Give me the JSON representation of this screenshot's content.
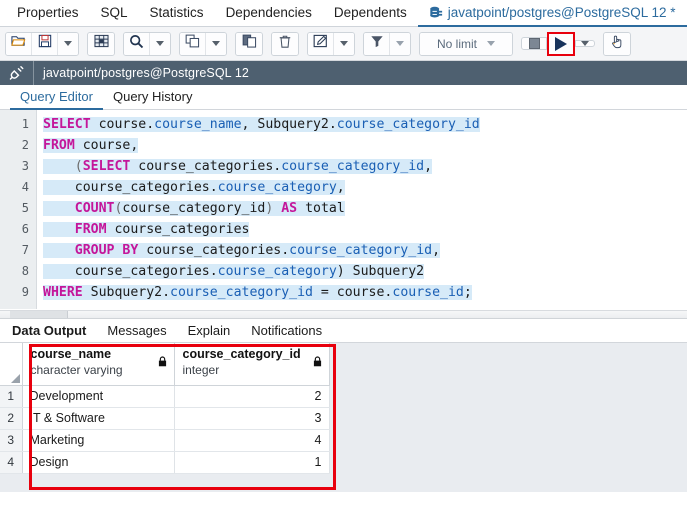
{
  "object_tabs": [
    {
      "label": "Properties",
      "active": false,
      "icon": null
    },
    {
      "label": "SQL",
      "active": false,
      "icon": null
    },
    {
      "label": "Statistics",
      "active": false,
      "icon": null
    },
    {
      "label": "Dependencies",
      "active": false,
      "icon": null
    },
    {
      "label": "Dependents",
      "active": false,
      "icon": null
    },
    {
      "label": "javatpoint/postgres@PostgreSQL 12 *",
      "active": true,
      "icon": "database-icon"
    }
  ],
  "toolbar": {
    "open_file_label": "open-file",
    "save_file_label": "save-file",
    "save_caret_label": "save-options",
    "edit_grid_label": "edit-grid",
    "find_label": "find",
    "find_caret_label": "find-options",
    "copy_label": "copy",
    "copy_caret_label": "copy-options",
    "paste_label": "paste",
    "delete_label": "delete",
    "edit_label": "edit-options",
    "edit_caret_label": "edit-caret",
    "filter_label": "filter",
    "filter_caret_label": "filter-options",
    "row_limit_value": "No limit",
    "stop_label": "stop",
    "execute_label": "execute-query",
    "execute_caret_label": "execute-options",
    "commit_label": "macro"
  },
  "connection": {
    "icon": "plug-icon",
    "text": "javatpoint/postgres@PostgreSQL 12"
  },
  "query_tabs": [
    {
      "label": "Query Editor",
      "active": true
    },
    {
      "label": "Query History",
      "active": false
    }
  ],
  "editor": {
    "line_numbers": [
      "1",
      "2",
      "3",
      "4",
      "5",
      "6",
      "7",
      "8",
      "9"
    ],
    "lines": [
      [
        {
          "t": "SELECT",
          "c": "kw"
        },
        {
          "t": " course.",
          "c": "pl"
        },
        {
          "t": "course_name",
          "c": "fld"
        },
        {
          "t": ", Subquery2.",
          "c": "pl"
        },
        {
          "t": "course_category_id",
          "c": "fld"
        }
      ],
      [
        {
          "t": "FROM",
          "c": "kw"
        },
        {
          "t": " course,",
          "c": "pl"
        }
      ],
      [
        {
          "t": "    (",
          "c": "punc"
        },
        {
          "t": "SELECT",
          "c": "kw"
        },
        {
          "t": " course_categories.",
          "c": "pl"
        },
        {
          "t": "course_category_id",
          "c": "fld"
        },
        {
          "t": ",",
          "c": "pl"
        }
      ],
      [
        {
          "t": "    course_categories.",
          "c": "pl"
        },
        {
          "t": "course_category",
          "c": "fld"
        },
        {
          "t": ",",
          "c": "pl"
        }
      ],
      [
        {
          "t": "    ",
          "c": "pl"
        },
        {
          "t": "COUNT",
          "c": "kw"
        },
        {
          "t": "(",
          "c": "punc"
        },
        {
          "t": "course_category_id",
          "c": "pl"
        },
        {
          "t": ") ",
          "c": "punc"
        },
        {
          "t": "AS",
          "c": "kw"
        },
        {
          "t": " total",
          "c": "pl"
        }
      ],
      [
        {
          "t": "    ",
          "c": "pl"
        },
        {
          "t": "FROM",
          "c": "kw"
        },
        {
          "t": " course_categories",
          "c": "pl"
        }
      ],
      [
        {
          "t": "    ",
          "c": "pl"
        },
        {
          "t": "GROUP BY",
          "c": "kw"
        },
        {
          "t": " course_categories.",
          "c": "pl"
        },
        {
          "t": "course_category_id",
          "c": "fld"
        },
        {
          "t": ",",
          "c": "pl"
        }
      ],
      [
        {
          "t": "    course_categories.",
          "c": "pl"
        },
        {
          "t": "course_category",
          "c": "fld"
        },
        {
          "t": ") Subquery2",
          "c": "pl"
        }
      ],
      [
        {
          "t": "WHERE",
          "c": "kw"
        },
        {
          "t": " Subquery2.",
          "c": "pl"
        },
        {
          "t": "course_category_id",
          "c": "fld"
        },
        {
          "t": " = course.",
          "c": "pl"
        },
        {
          "t": "course_id",
          "c": "fld"
        },
        {
          "t": ";",
          "c": "pl"
        }
      ]
    ]
  },
  "output_tabs": [
    {
      "label": "Data Output",
      "active": true
    },
    {
      "label": "Messages",
      "active": false
    },
    {
      "label": "Explain",
      "active": false
    },
    {
      "label": "Notifications",
      "active": false
    }
  ],
  "result_grid": {
    "columns": [
      {
        "name": "course_name",
        "type": "character varying",
        "lock": "lock-icon",
        "width": 152
      },
      {
        "name": "course_category_id",
        "type": "integer",
        "lock": "lock-icon",
        "width": 155
      }
    ],
    "rows": [
      {
        "num": "1",
        "course_name": "Development",
        "course_category_id": "2"
      },
      {
        "num": "2",
        "course_name": "IT & Software",
        "course_category_id": "3"
      },
      {
        "num": "3",
        "course_name": "Marketing",
        "course_category_id": "4"
      },
      {
        "num": "4",
        "course_name": "Design",
        "course_category_id": "1"
      }
    ]
  },
  "colors": {
    "accent_blue": "#2c6b9e",
    "highlight_red": "#e8000d",
    "connbar_bg": "#4e6070",
    "keyword": "#c4169a",
    "field": "#1a5fb4",
    "selection": "#d6eaf8"
  }
}
